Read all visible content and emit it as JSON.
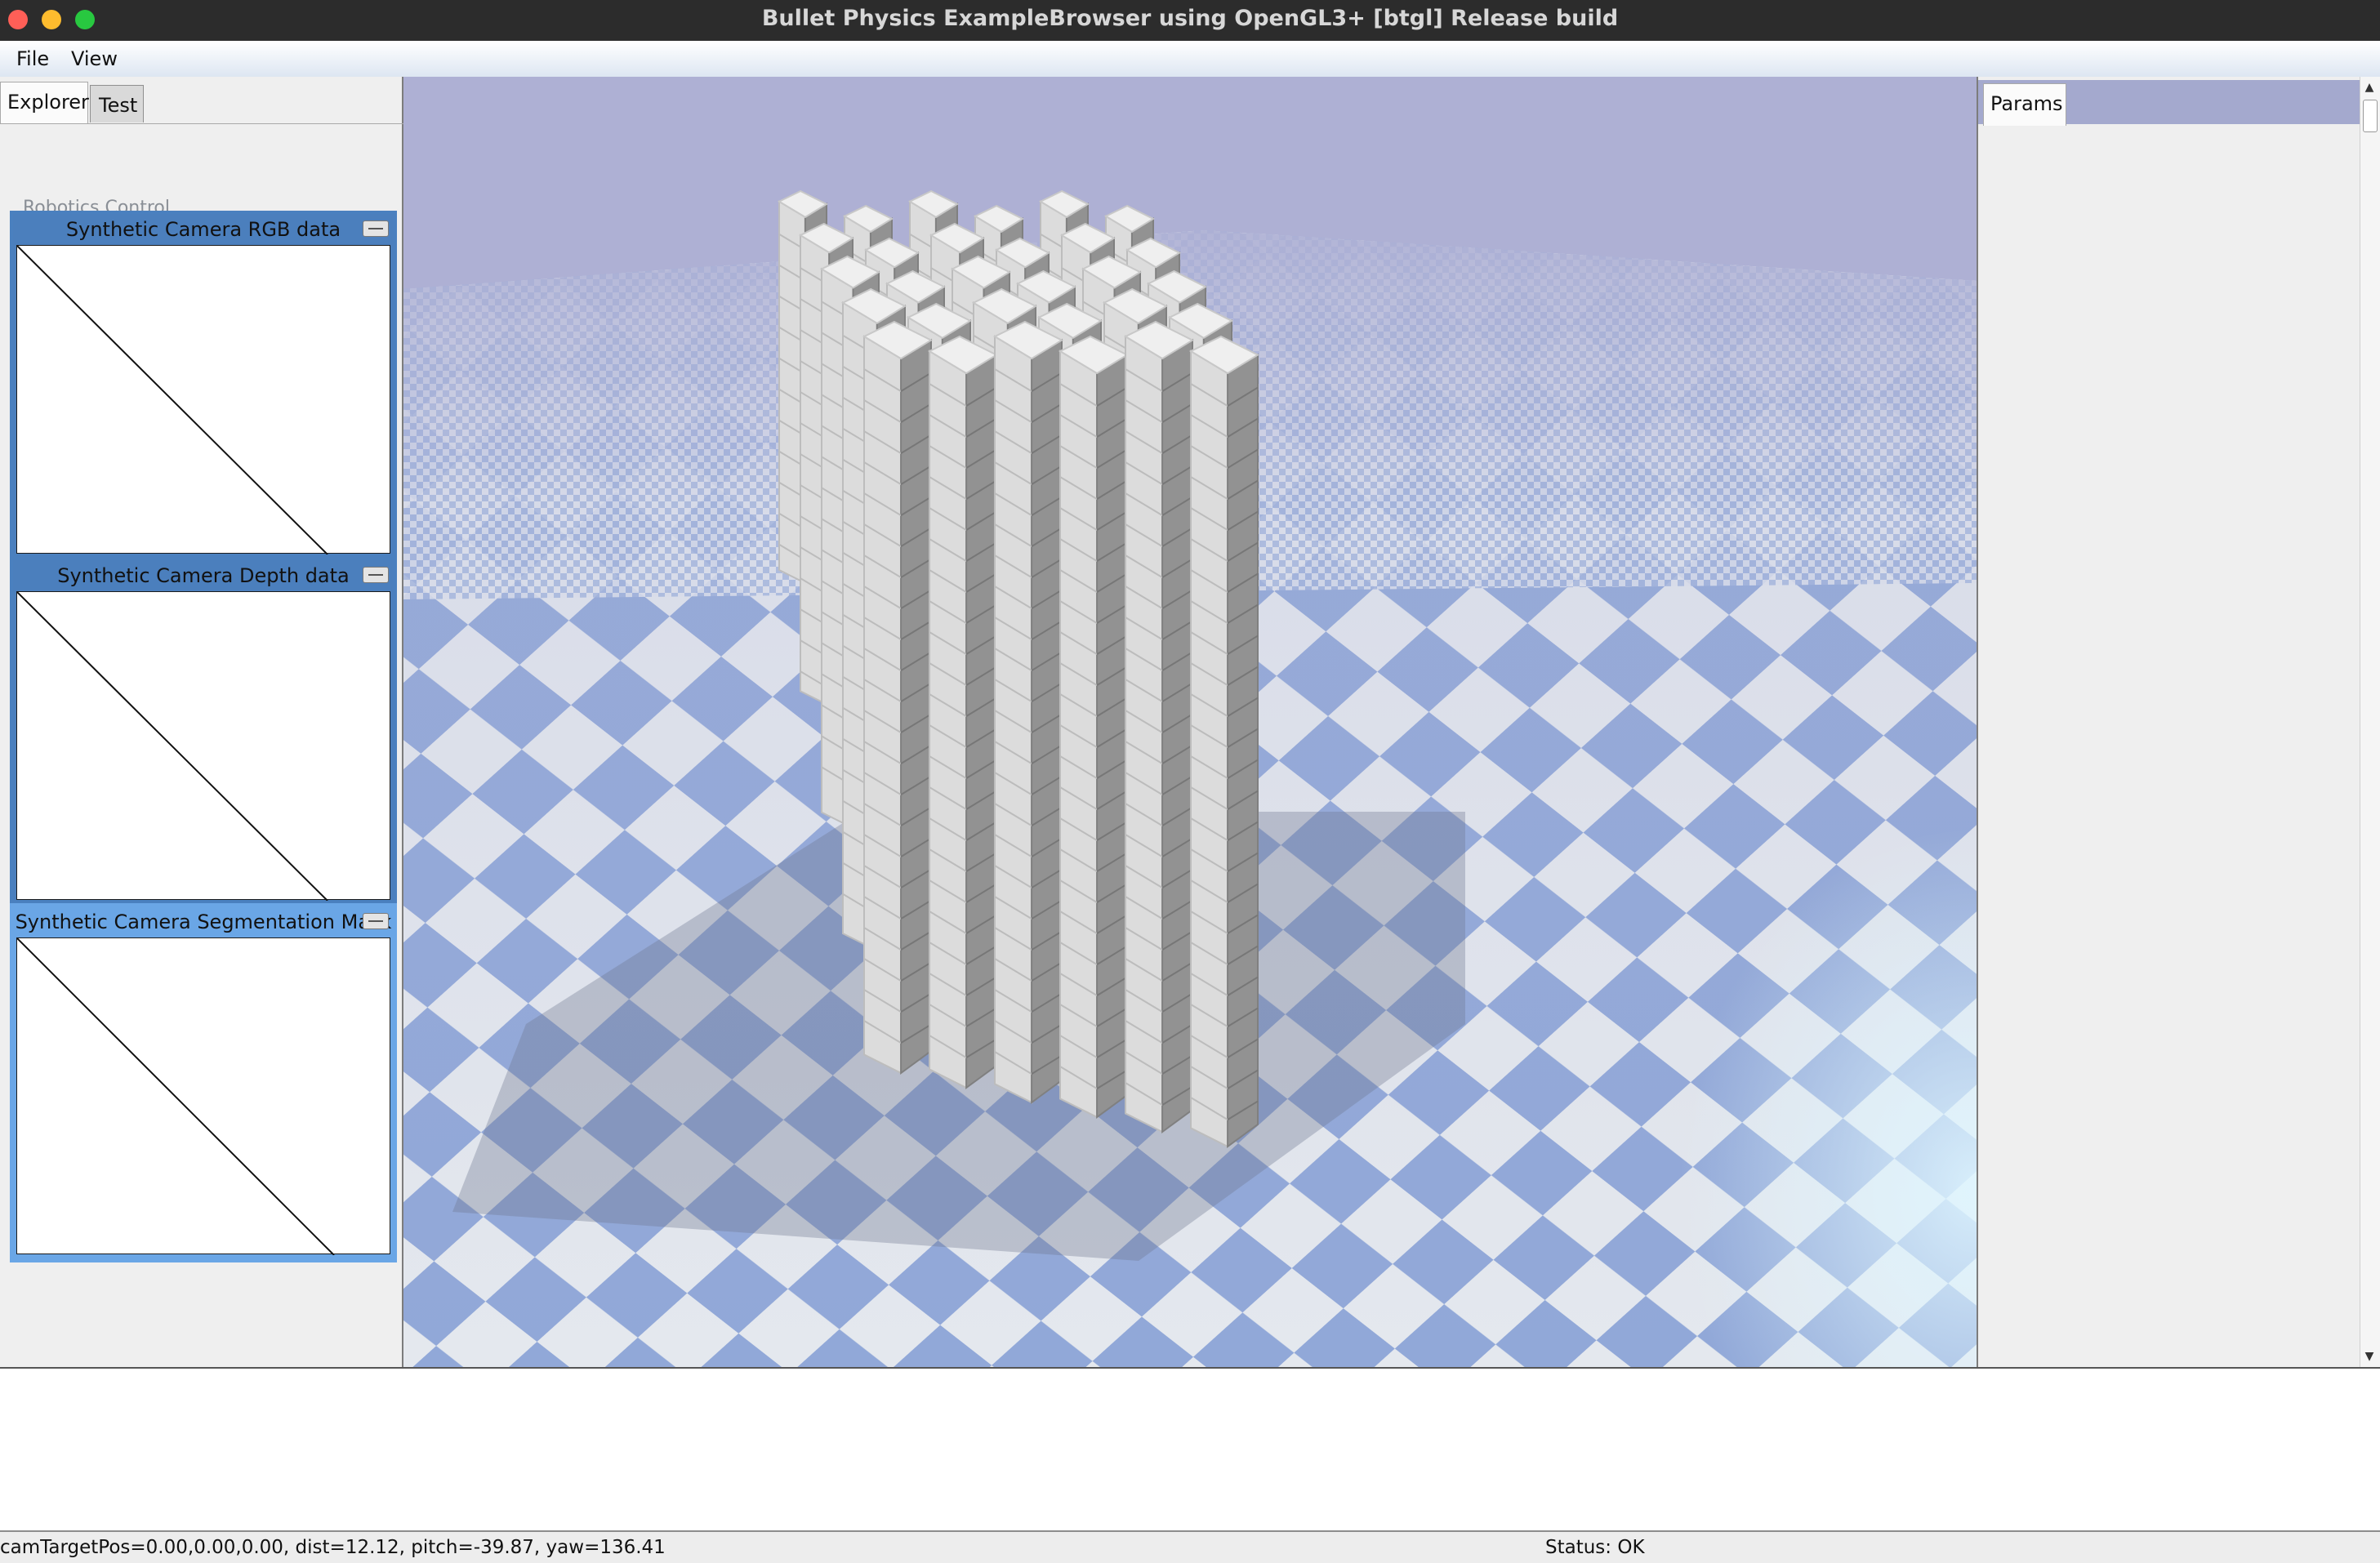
{
  "window": {
    "title": "Bullet Physics ExampleBrowser using OpenGL3+ [btgl] Release build"
  },
  "menu": {
    "items": [
      "File",
      "View"
    ]
  },
  "left_panel": {
    "tabs": [
      "Explorer",
      "Test"
    ],
    "active_tab": "Explorer",
    "tree_header": "Robotics Control"
  },
  "camera_windows": [
    {
      "title": "Synthetic Camera RGB data"
    },
    {
      "title": "Synthetic Camera Depth data"
    },
    {
      "title": "Synthetic Camera Segmentation Mask"
    }
  ],
  "right_panel": {
    "tab": "Params"
  },
  "status": {
    "camera": "camTargetPos=0.00,0.00,0.00, dist=12.12, pitch=-39.87, yaw=136.41",
    "state": "Status: OK"
  },
  "colors": {
    "titlebar": "#2c2c2c",
    "sky": "#aeb0d4",
    "checker_blue": "#91a8d8",
    "checker_white": "#e4e8ee",
    "window_frame": "#4a80bf",
    "window_frame_active": "#6aa6e6"
  }
}
